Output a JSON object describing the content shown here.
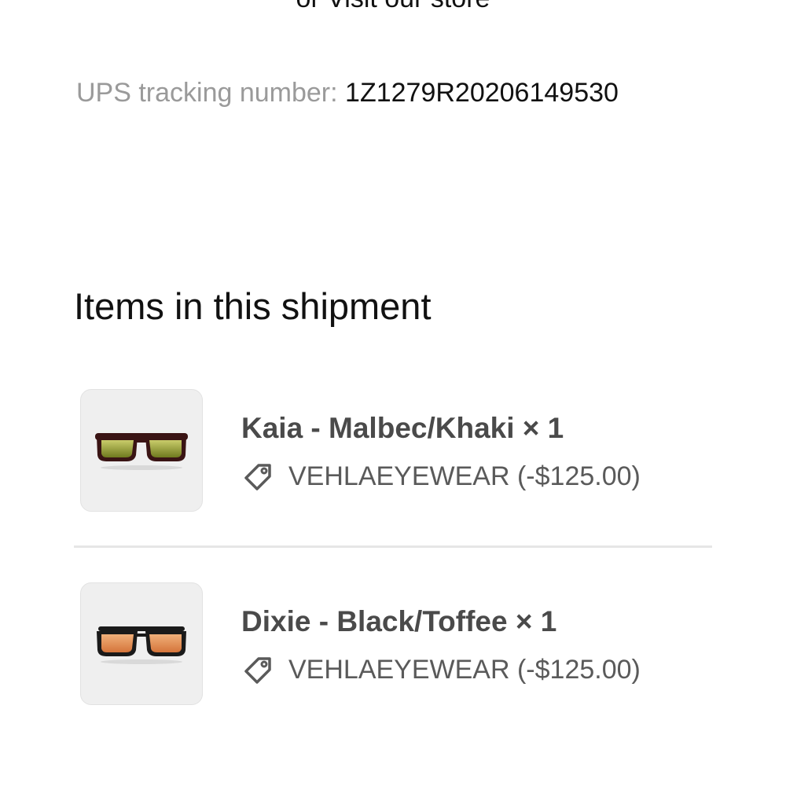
{
  "store_link": "or Visit our store",
  "tracking": {
    "label": "UPS tracking number:",
    "number": "1Z1279R20206149530"
  },
  "section_title": "Items in this shipment",
  "items": [
    {
      "name": "Kaia - Malbec/Khaki × 1",
      "discount": "VEHLAEYEWEAR (-$125.00)",
      "thumbnail_icon": "sunglasses-icon",
      "frame_color": "#3a1414",
      "lens_color": "#9aa63a"
    },
    {
      "name": "Dixie - Black/Toffee × 1",
      "discount": "VEHLAEYEWEAR (-$125.00)",
      "thumbnail_icon": "sunglasses-icon",
      "frame_color": "#1a1a1a",
      "lens_color": "#e0925a"
    }
  ],
  "discount_icon": "tag-icon"
}
